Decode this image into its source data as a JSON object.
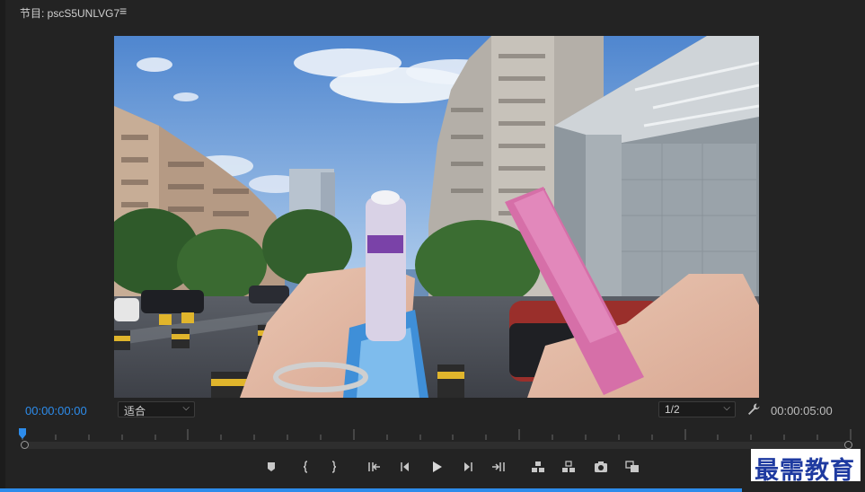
{
  "panel": {
    "title": "节目: pscS5UNLVG7",
    "menu_icon": "≡"
  },
  "timecode": {
    "current": "00:00:00:00",
    "duration": "00:00:05:00"
  },
  "fit_dropdown": {
    "selected": "适合"
  },
  "resolution_dropdown": {
    "selected": "1/2"
  },
  "playback": {
    "position_fraction": 0
  },
  "controls": [
    {
      "name": "add-marker-button",
      "icon": "marker-icon"
    },
    {
      "name": "mark-in-button",
      "icon": "brace-left-icon"
    },
    {
      "name": "mark-out-button",
      "icon": "brace-right-icon"
    },
    {
      "name": "go-to-in-button",
      "icon": "go-to-in-icon"
    },
    {
      "name": "step-back-button",
      "icon": "step-back-icon"
    },
    {
      "name": "play-button",
      "icon": "play-icon"
    },
    {
      "name": "step-forward-button",
      "icon": "step-forward-icon"
    },
    {
      "name": "go-to-out-button",
      "icon": "go-to-out-icon"
    },
    {
      "name": "lift-button",
      "icon": "lift-icon"
    },
    {
      "name": "extract-button",
      "icon": "extract-icon"
    },
    {
      "name": "export-frame-button",
      "icon": "camera-icon"
    },
    {
      "name": "compare-view-button",
      "icon": "compare-icon"
    }
  ],
  "colors": {
    "accent": "#2d8ceb",
    "background": "#232323",
    "watermark_text": "#1e3aa0"
  },
  "watermark": {
    "text": "最需教育"
  }
}
